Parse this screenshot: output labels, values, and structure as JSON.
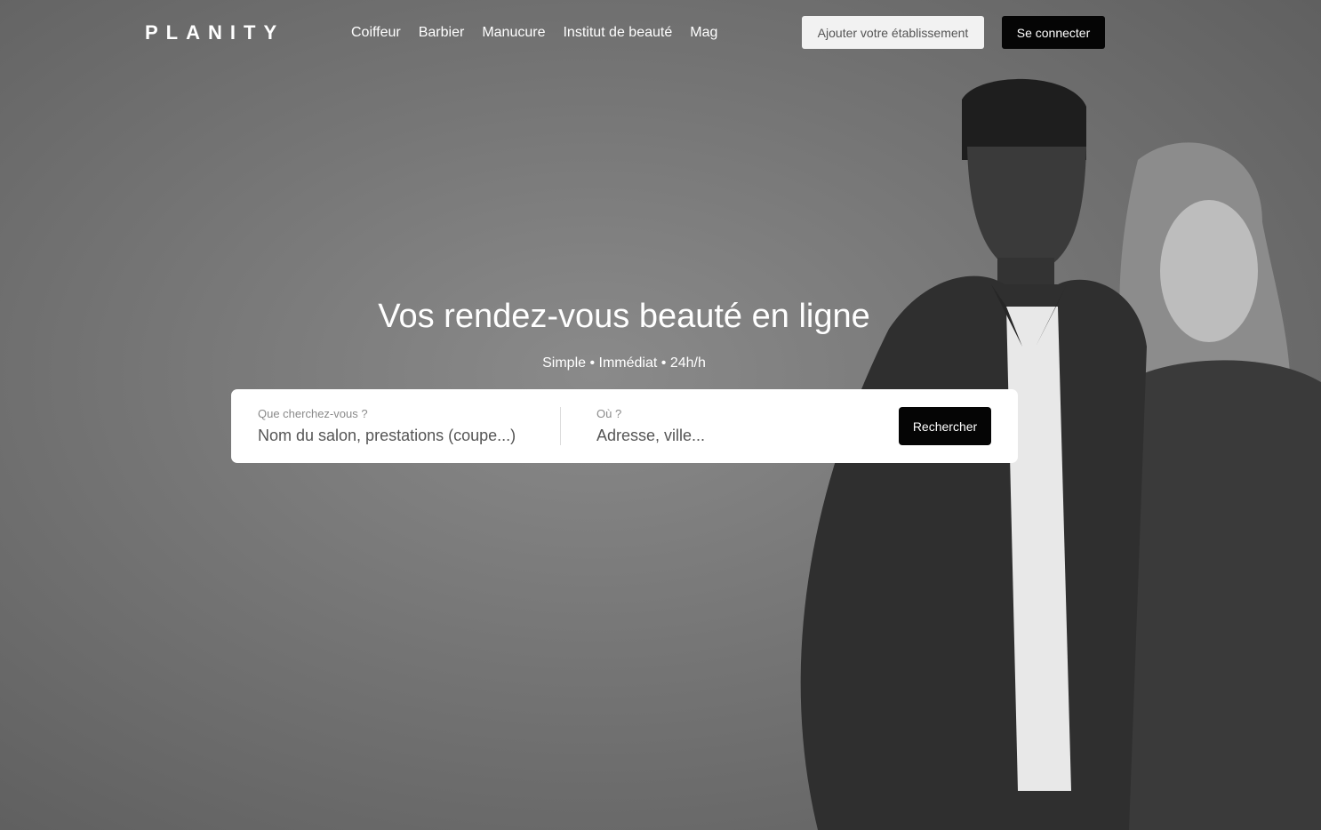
{
  "header": {
    "logo": "PLANITY",
    "nav": [
      "Coiffeur",
      "Barbier",
      "Manucure",
      "Institut de beauté",
      "Mag"
    ],
    "add_business_label": "Ajouter votre établissement",
    "login_label": "Se connecter"
  },
  "hero": {
    "headline": "Vos rendez-vous beauté en ligne",
    "tagline": "Simple • Immédiat • 24h/h"
  },
  "search": {
    "what_label": "Que cherchez-vous ?",
    "what_placeholder": "Nom du salon, prestations (coupe...)",
    "where_label": "Où ?",
    "where_placeholder": "Adresse, ville...",
    "button_label": "Rechercher"
  },
  "colors": {
    "background": "#777777",
    "button_dark": "#050505",
    "button_light": "#f2f2f2",
    "text_light": "#ffffff"
  }
}
